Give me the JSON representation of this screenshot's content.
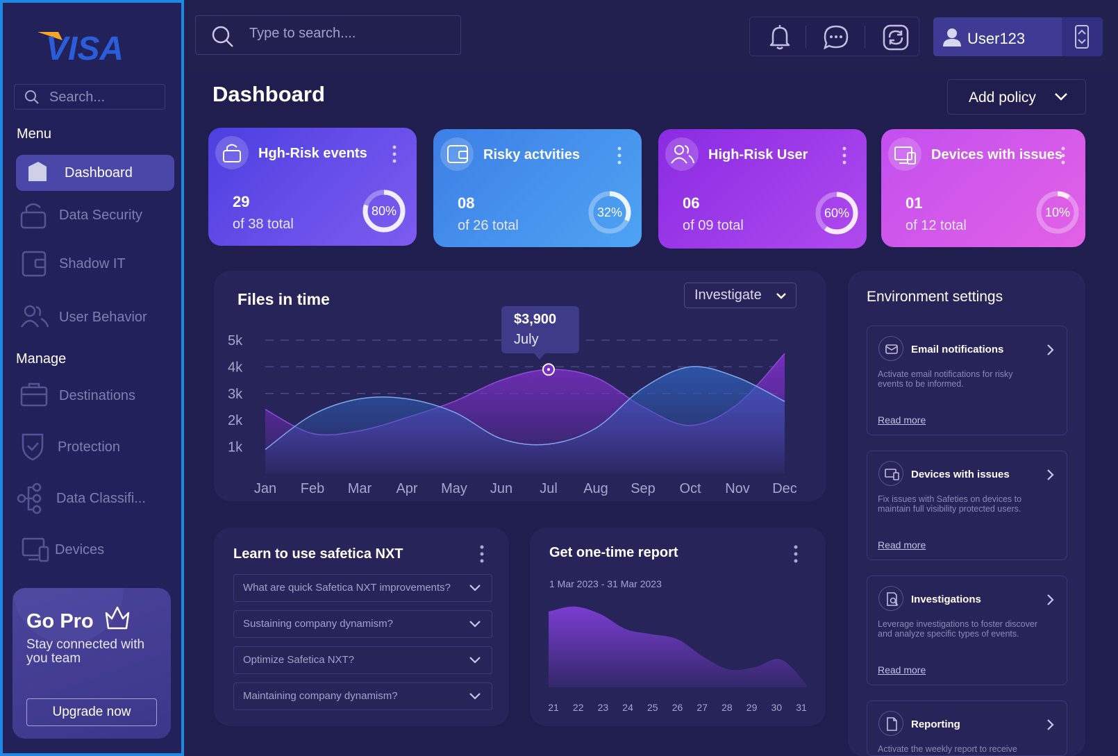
{
  "brand": {
    "logo_text": "VISA"
  },
  "sidebar": {
    "search_placeholder": "Search...",
    "menu_label": "Menu",
    "manage_label": "Manage",
    "menu_items": [
      {
        "label": "Dashboard",
        "icon": "home-icon",
        "active": true
      },
      {
        "label": "Data Security",
        "icon": "lock-icon"
      },
      {
        "label": "Shadow IT",
        "icon": "wallet-icon"
      },
      {
        "label": "User Behavior",
        "icon": "users-icon"
      }
    ],
    "manage_items": [
      {
        "label": "Destinations",
        "icon": "briefcase-icon"
      },
      {
        "label": "Protection",
        "icon": "shield-icon"
      },
      {
        "label": "Data Classifi...",
        "icon": "hierarchy-icon"
      },
      {
        "label": "Devices",
        "icon": "devices-icon"
      }
    ],
    "promo": {
      "title": "Go Pro",
      "subtitle": "Stay connected with you team",
      "button": "Upgrade now",
      "icon": "crown-icon"
    }
  },
  "topbar": {
    "search_placeholder": "Type to search....",
    "icons": [
      "bell-icon",
      "chat-icon",
      "sync-icon"
    ],
    "user": {
      "name": "User123",
      "icon": "user-icon"
    }
  },
  "page": {
    "title": "Dashboard",
    "add_policy_label": "Add policy"
  },
  "cards": [
    {
      "title": "Hgh-Risk events",
      "value": "29",
      "sub": "of 38 total",
      "percent": 80,
      "percent_label": "80%",
      "icon": "lock-icon",
      "color_from": "#4d3fe0",
      "color_to": "#7d5cf0"
    },
    {
      "title": "Risky actvities",
      "value": "08",
      "sub": "of 26 total",
      "percent": 32,
      "percent_label": "32%",
      "icon": "wallet-icon",
      "color_from": "#3d7fe6",
      "color_to": "#4ea3f3"
    },
    {
      "title": "High-Risk User",
      "value": "06",
      "sub": "of 09 total",
      "percent": 60,
      "percent_label": "60%",
      "icon": "users-icon",
      "color_from": "#8a2be2",
      "color_to": "#b04aef"
    },
    {
      "title": "Devices with issues",
      "value": "01",
      "sub": "of 12 total",
      "percent": 10,
      "percent_label": "10%",
      "icon": "devices-icon",
      "color_from": "#c34fee",
      "color_to": "#e262e6"
    }
  ],
  "files_chart": {
    "title": "Files in time",
    "dropdown": "Investigate",
    "tooltip": {
      "value": "$3,900",
      "label": "July"
    }
  },
  "chart_data": [
    {
      "type": "area",
      "title": "Files in time",
      "x": [
        "Jan",
        "Feb",
        "Mar",
        "Apr",
        "May",
        "Jun",
        "Jul",
        "Aug",
        "Sep",
        "Oct",
        "Nov",
        "Dec"
      ],
      "yticks": [
        "5k",
        "4k",
        "3k",
        "2k",
        "1k"
      ],
      "ylim": [
        0,
        5000
      ],
      "grid": true,
      "series": [
        {
          "color": "#7a2fc4",
          "values": [
            2400,
            1500,
            1600,
            2100,
            2700,
            3500,
            3900,
            3600,
            2500,
            1800,
            2600,
            4500
          ]
        },
        {
          "color": "#2f5fb8",
          "values": [
            900,
            2200,
            2800,
            2800,
            2300,
            1300,
            1100,
            1700,
            3200,
            4000,
            3600,
            2700
          ]
        }
      ]
    },
    {
      "type": "area",
      "title": "Get one-time report",
      "x": [
        "21",
        "22",
        "23",
        "24",
        "25",
        "26",
        "27",
        "28",
        "29",
        "30",
        "31"
      ],
      "series": [
        {
          "color": "#7a3dd0",
          "values": [
            3.0,
            3.2,
            2.9,
            2.3,
            2.1,
            1.9,
            1.2,
            0.7,
            0.8,
            1.1,
            0.1
          ]
        }
      ]
    }
  ],
  "learn": {
    "title": "Learn to use safetica NXT",
    "items": [
      "What are quick Safetica NXT improvements?",
      "Sustaining company dynamism?",
      "Optimize Safetica NXT?",
      "Maintaining company dynamism?"
    ]
  },
  "report": {
    "title": "Get one-time report",
    "range": "1 Mar 2023 - 31 Mar 2023"
  },
  "env": {
    "title": "Environment settings",
    "items": [
      {
        "title": "Email notifications",
        "desc": "Activate email notifications for risky events to be informed.",
        "link": "Read more",
        "icon": "mail-icon"
      },
      {
        "title": "Devices with issues",
        "desc": "Fix issues with Safeties on devices to maintain full visibility protected users.",
        "link": "Read more",
        "icon": "devices-icon"
      },
      {
        "title": "Investigations",
        "desc": "Leverage investigations to foster discover and analyze specific types of events.",
        "link": "Read more",
        "icon": "search-doc-icon"
      },
      {
        "title": "Reporting",
        "desc": "Activate the weekly report to receive",
        "link": "",
        "icon": "document-icon"
      }
    ]
  }
}
